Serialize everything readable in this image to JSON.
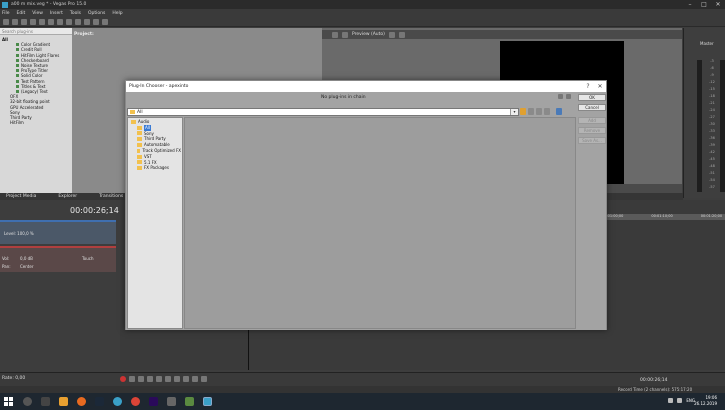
{
  "window": {
    "title": "a00 m mix.veg * - Vegas Pro 15.0"
  },
  "menu": [
    "File",
    "Edit",
    "View",
    "Insert",
    "Tools",
    "Options",
    "Help"
  ],
  "left_panel": {
    "search_placeholder": "Search plug-ins",
    "tree": [
      "All",
      "Color Gradient",
      "Credit Roll",
      "HitFilm Light Flares",
      "Checkerboard",
      "Noise Texture",
      "ProType Titler",
      "Solid Color",
      "Test Pattern",
      "Titles & Text",
      "(Legacy) Text",
      "OFX",
      "32-bit floating point",
      "GPU Accelerated",
      "Sony",
      "Third Party",
      "HitFilm"
    ]
  },
  "project": {
    "label": "Project:"
  },
  "preview": {
    "quality": "Preview (Auto)"
  },
  "master": {
    "label": "Master",
    "scale": [
      "-3",
      "-6",
      "-9",
      "-12",
      "-15",
      "-18",
      "-21",
      "-24",
      "-27",
      "-30",
      "-33",
      "-36",
      "-39",
      "-42",
      "-45",
      "-48",
      "-51",
      "-54",
      "-57"
    ]
  },
  "tabs": [
    "Project Media",
    "Explorer",
    "Transitions",
    "Video"
  ],
  "timeline": {
    "timecode": "00:00:26;14",
    "track1": {
      "level": "Level: 100,0 %"
    },
    "track2": {
      "vol": "Vol:",
      "vol_val": "0,0 dB",
      "pan": "Pan:",
      "pan_val": "Center",
      "touch": "Touch"
    },
    "ruler": [
      "00:01:00;00",
      "00:01:10;00",
      "00:01:20;00"
    ]
  },
  "bottom": {
    "rate": "Rate: 0,00",
    "timecode": "00:00:26;14",
    "status": "Record Time (2 channels): 575:17:20"
  },
  "taskbar": {
    "time": "19:06",
    "date": "26.12.2019",
    "lang": "ENG"
  },
  "dialog": {
    "title": "Plug-In Chooser - apexinto",
    "help": "?",
    "close": "✕",
    "chain_text": "No plug-ins in chain",
    "path": "All",
    "buttons": {
      "ok": "OK",
      "cancel": "Cancel",
      "add": "Add",
      "remove": "Remove",
      "save_as": "Save As..."
    },
    "folders": [
      {
        "label": "Audio",
        "indent": 1,
        "selected": false
      },
      {
        "label": "All",
        "indent": 2,
        "selected": true
      },
      {
        "label": "Sony",
        "indent": 2,
        "selected": false
      },
      {
        "label": "Third Party",
        "indent": 2,
        "selected": false
      },
      {
        "label": "Automatable",
        "indent": 2,
        "selected": false
      },
      {
        "label": "Track Optimized FX",
        "indent": 2,
        "selected": false
      },
      {
        "label": "VST",
        "indent": 2,
        "selected": false
      },
      {
        "label": "5.1 FX",
        "indent": 2,
        "selected": false
      },
      {
        "label": "FX Packages",
        "indent": 2,
        "selected": false
      }
    ]
  }
}
